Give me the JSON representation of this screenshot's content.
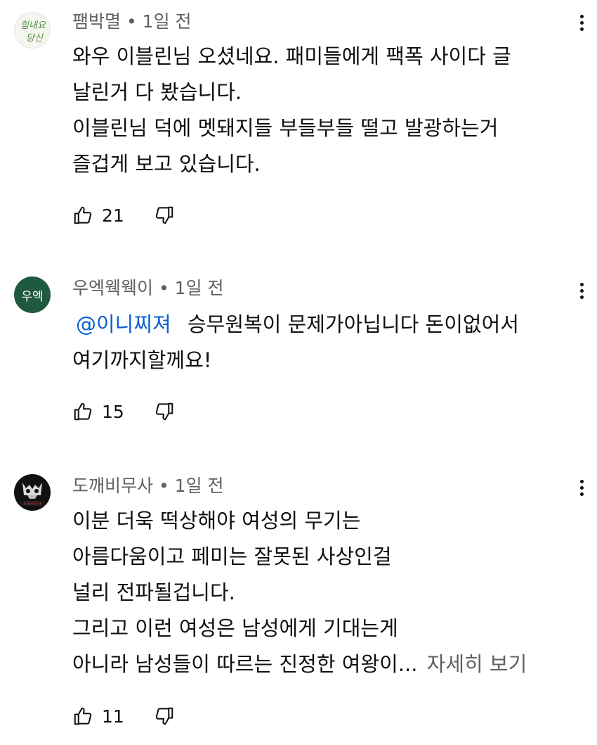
{
  "comments": [
    {
      "author": "팸박멸",
      "time": "1일 전",
      "avatar_text": [
        "힘내요",
        "당신"
      ],
      "lines": [
        "와우 이블린님 오셨네요. 패미들에게 팩폭 사이다 글",
        "날린거 다 봤습니다.",
        "이블린님 덕에 멧돼지들 부들부들 떨고 발광하는거",
        "즐겁게 보고 있습니다."
      ],
      "likes": "21"
    },
    {
      "author": "우엑웩웩이",
      "time": "1일 전",
      "avatar_text": "우엑",
      "mention": "@이니찌져",
      "line1_rest": "승무원복이 문제가아닙니다 돈이없어서",
      "line2": "여기까지할께요!",
      "likes": "15"
    },
    {
      "author": "도깨비무사",
      "time": "1일 전",
      "avatar_text": "도깨비무사",
      "lines": [
        "이분 더욱 떡상해야 여성의 무기는",
        "아름다움이고 페미는 잘못된 사상인걸",
        "널리 전파될겁니다.",
        "그리고 이런 여성은 남성에게 기대는게"
      ],
      "last_line": "아니라 남성들이 따르는 진정한 여왕이...",
      "read_more": "자세히 보기",
      "likes": "11"
    }
  ],
  "meta_separator": "•",
  "colors": {
    "text": "#0f0f0f",
    "secondary": "#606060",
    "mention": "#065fd4",
    "avatar2_bg": "#1f5a3e"
  },
  "icons": [
    "like-icon",
    "dislike-icon",
    "more-vert-icon"
  ]
}
